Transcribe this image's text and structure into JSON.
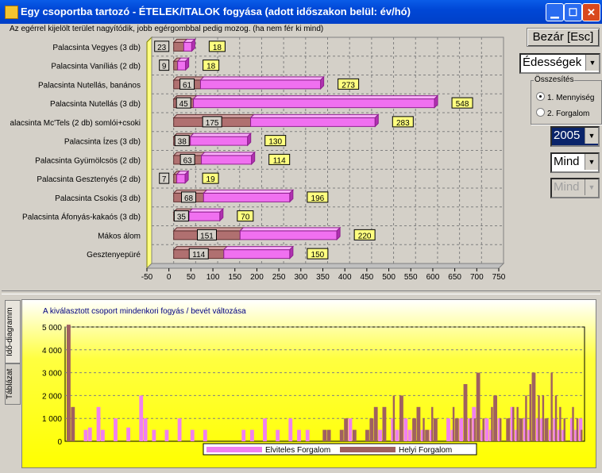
{
  "window": {
    "title": "Egy csoportba tartozó - ÉTELEK/ITALOK fogyása (adott időszakon belül: év/hó)",
    "controls": [
      "minimize",
      "maximize",
      "close"
    ]
  },
  "hint": "Az egérrel kijelölt terület nagyítódik, jobb egérgombbal pedig mozog. (ha nem fér ki mind)",
  "right_panel": {
    "close_button": "Bezár [Esc]",
    "category_combo": "Édességek",
    "group_label": "Összesítés",
    "radio_options": [
      {
        "label": "1. Mennyiség",
        "selected": true
      },
      {
        "label": "2. Forgalom",
        "selected": false
      }
    ],
    "year_combo": "2005",
    "month_combo": "Mind",
    "day_combo": "Mind"
  },
  "side_tabs": [
    "Idő-diagramm",
    "Táblázat"
  ],
  "chart_data": [
    {
      "type": "bar",
      "orientation": "horizontal",
      "stacked": true,
      "categories": [
        "Palacsinta Vegyes (3 db)",
        "Palacsinta Vaníliás (2 db)",
        "Palacsinta Nutellás, banános",
        "Palacsinta Nutellás (3 db)",
        "alacsinta Mc'Tels (2 db) somlói+csoki",
        "Palacsinta Ízes (3 db)",
        "Palacsinta Gyümölcsös (2 db)",
        "Palacsinta Gesztenyés (2 db)",
        "Palacsinta Csokis (3 db)",
        "Palacsinta Áfonyás-kakaós (3 db)",
        "Mákos álom",
        "Gesztenyepüré"
      ],
      "series": [
        {
          "name": "Helyi",
          "values": [
            23,
            9,
            61,
            45,
            175,
            38,
            63,
            7,
            68,
            35,
            151,
            114
          ],
          "color": "#b07070"
        },
        {
          "name": "Elviteles",
          "values": [
            18,
            18,
            273,
            548,
            283,
            130,
            114,
            19,
            196,
            70,
            220,
            150
          ],
          "color": "#f070f0"
        }
      ],
      "xlim": [
        -50,
        750
      ],
      "xticks": [
        -50,
        0,
        50,
        100,
        150,
        200,
        250,
        300,
        350,
        400,
        450,
        500,
        550,
        600,
        650,
        700,
        750
      ],
      "grid": true
    },
    {
      "type": "bar",
      "title": "A kiválasztott csoport mindenkori fogyás / bevét változása",
      "series": [
        {
          "name": "Elviteles Forgalom",
          "color": "#f080f0",
          "values": [
            0,
            0,
            0,
            0,
            500,
            600,
            0,
            1500,
            500,
            0,
            0,
            1000,
            0,
            0,
            600,
            0,
            0,
            2000,
            1000,
            0,
            500,
            0,
            0,
            500,
            0,
            0,
            1000,
            0,
            0,
            500,
            0,
            0,
            500,
            0,
            0,
            0,
            0,
            0,
            0,
            0,
            0,
            500,
            0,
            500,
            0,
            0,
            1000,
            0,
            0,
            500,
            0,
            0,
            1000,
            0,
            500,
            0,
            500,
            0,
            0,
            0,
            0,
            0,
            0,
            0,
            0,
            0,
            1000,
            0,
            0,
            0,
            0,
            0,
            0,
            500,
            0,
            0,
            1000,
            500,
            0,
            1000,
            500,
            0,
            0,
            500,
            0,
            500,
            0,
            0,
            0,
            1000,
            500,
            0,
            1000,
            0,
            1000,
            1500,
            0,
            500,
            1000,
            500,
            0,
            1000,
            0,
            0,
            1500,
            500,
            0,
            1000,
            500,
            0,
            1000,
            1000,
            0,
            500,
            1000,
            500,
            500,
            0,
            1000,
            500,
            1000
          ]
        },
        {
          "name": "Helyi Forgalom",
          "color": "#a06060",
          "values": [
            5100,
            1500,
            0,
            0,
            0,
            0,
            0,
            0,
            0,
            0,
            0,
            0,
            0,
            0,
            0,
            0,
            0,
            0,
            0,
            0,
            0,
            0,
            0,
            0,
            0,
            0,
            0,
            0,
            0,
            0,
            0,
            0,
            0,
            0,
            0,
            0,
            0,
            0,
            0,
            0,
            0,
            0,
            0,
            0,
            0,
            0,
            0,
            0,
            0,
            0,
            0,
            0,
            0,
            0,
            0,
            0,
            0,
            0,
            0,
            0,
            500,
            500,
            0,
            0,
            500,
            1000,
            0,
            500,
            0,
            0,
            500,
            1000,
            1500,
            0,
            1500,
            0,
            2000,
            0,
            2000,
            0,
            0,
            1000,
            1500,
            1000,
            500,
            1500,
            1000,
            0,
            0,
            0,
            1500,
            1000,
            0,
            2500,
            1000,
            1000,
            3000,
            1000,
            0,
            1500,
            2000,
            1000,
            0,
            1000,
            1500,
            1500,
            1000,
            2000,
            2500,
            3000,
            2000,
            2000,
            1000,
            3000,
            2000,
            1500,
            1000,
            0,
            1500,
            1000,
            500,
            1500
          ]
        }
      ],
      "ylim": [
        0,
        5000
      ],
      "yticks": [
        "0",
        "1 000",
        "2 000",
        "3 000",
        "4 000",
        "5 000"
      ],
      "grid": true,
      "legend": "bottom-center",
      "legend_entries": [
        "Elviteles Forgalom",
        "Helyi Forgalom"
      ]
    }
  ]
}
